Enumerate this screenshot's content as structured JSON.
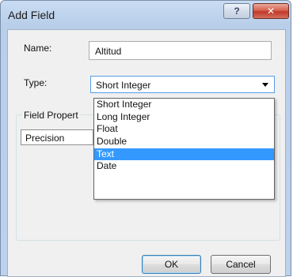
{
  "window": {
    "title": "Add Field",
    "help_glyph": "?",
    "close_glyph": "✕"
  },
  "form": {
    "name_label": "Name:",
    "name_value": "Altitud",
    "type_label": "Type:",
    "type_value": "Short Integer",
    "group_title": "Field Propert",
    "property_cell": "Precision"
  },
  "dropdown": {
    "options": [
      "Short Integer",
      "Long Integer",
      "Float",
      "Double",
      "Text",
      "Date"
    ],
    "highlighted": "Text"
  },
  "buttons": {
    "ok": "OK",
    "cancel": "Cancel"
  },
  "colors": {
    "highlight": "#3399ff",
    "close_button": "#c0392b",
    "titlebar": "#c9dcf3"
  }
}
